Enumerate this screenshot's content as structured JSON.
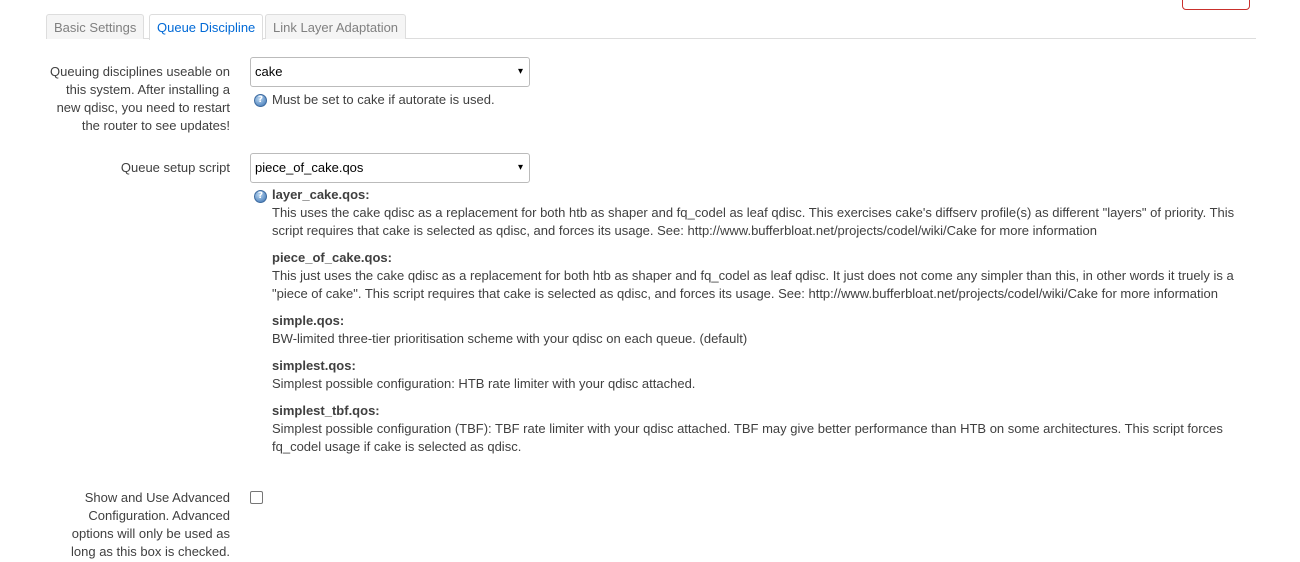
{
  "tabs": [
    {
      "label": "Basic Settings"
    },
    {
      "label": "Queue Discipline"
    },
    {
      "label": "Link Layer Adaptation"
    }
  ],
  "qdisc": {
    "label": "Queuing disciplines useable on this system. After installing a new qdisc, you need to restart the router to see updates!",
    "value": "cake",
    "help": "Must be set to cake if autorate is used."
  },
  "script": {
    "label": "Queue setup script",
    "value": "piece_of_cake.qos",
    "descriptions": [
      {
        "name": "layer_cake.qos:",
        "text": "This uses the cake qdisc as a replacement for both htb as shaper and fq_codel as leaf qdisc. This exercises cake's diffserv profile(s) as different \"layers\" of priority. This script requires that cake is selected as qdisc, and forces its usage. See: http://www.bufferbloat.net/projects/codel/wiki/Cake for more information"
      },
      {
        "name": "piece_of_cake.qos:",
        "text": "This just uses the cake qdisc as a replacement for both htb as shaper and fq_codel as leaf qdisc. It just does not come any simpler than this, in other words it truely is a \"piece of cake\". This script requires that cake is selected as qdisc, and forces its usage. See: http://www.bufferbloat.net/projects/codel/wiki/Cake for more information"
      },
      {
        "name": "simple.qos:",
        "text": "BW-limited three-tier prioritisation scheme with your qdisc on each queue. (default)"
      },
      {
        "name": "simplest.qos:",
        "text": "Simplest possible configuration: HTB rate limiter with your qdisc attached."
      },
      {
        "name": "simplest_tbf.qos:",
        "text": "Simplest possible configuration (TBF): TBF rate limiter with your qdisc attached. TBF may give better performance than HTB on some architectures. This script forces fq_codel usage if cake is selected as qdisc."
      }
    ]
  },
  "advanced": {
    "label": "Show and Use Advanced Configuration. Advanced options will only be used as long as this box is checked.",
    "checked": false
  },
  "icons": {
    "help": "?",
    "caret": "▾"
  }
}
